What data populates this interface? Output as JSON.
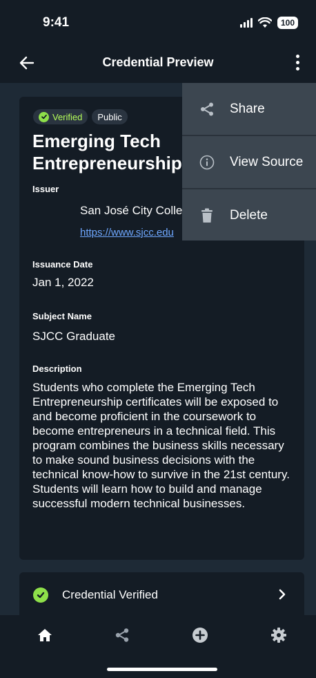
{
  "status_bar": {
    "time": "9:41",
    "battery": "100",
    "icons": [
      "signal-icon",
      "wifi-icon",
      "battery-icon"
    ]
  },
  "app_bar": {
    "title": "Credential Preview",
    "back_icon": "arrow-left-icon",
    "more_icon": "more-vertical-icon"
  },
  "credential": {
    "badges": {
      "verified": "Verified",
      "public": "Public"
    },
    "title": "Emerging Tech Entrepreneurship",
    "issuer_label": "Issuer",
    "issuer_name": "San José City College",
    "issuer_url": "https://www.sjcc.edu",
    "issuance_date_label": "Issuance Date",
    "issuance_date": "Jan 1, 2022",
    "subject_name_label": "Subject Name",
    "subject_name": "SJCC Graduate",
    "description_label": "Description",
    "description": "Students who complete the Emerging Tech Entrepreneurship certificates will be exposed to and become proficient in the coursework to become entrepreneurs in a technical field. This program combines the business skills necessary to make sound business decisions with the technical know-how to survive in the 21st century. Students will learn how to build and manage successful modern technical businesses."
  },
  "verification": {
    "label": "Credential Verified",
    "icon": "check-circle-icon"
  },
  "menu": {
    "items": [
      {
        "label": "Share",
        "icon": "share-icon"
      },
      {
        "label": "View Source",
        "icon": "info-icon"
      },
      {
        "label": "Delete",
        "icon": "trash-icon"
      }
    ]
  },
  "bottom_nav": {
    "items": [
      "home-icon",
      "share-icon",
      "plus-circle-icon",
      "gear-icon"
    ]
  },
  "colors": {
    "background": "#1e2a36",
    "surface": "#141c25",
    "menu": "#3c4650",
    "accent_green": "#8ee04a",
    "link": "#6fa8ff"
  }
}
